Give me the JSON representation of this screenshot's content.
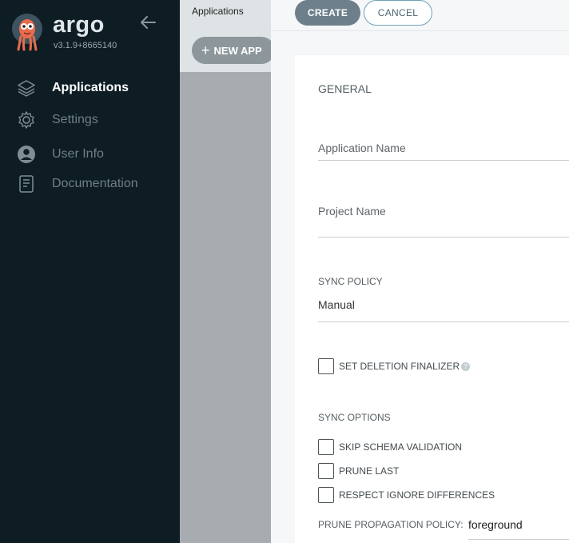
{
  "sidebar": {
    "brand": "argo",
    "version": "v3.1.9+8665140",
    "items": [
      {
        "label": "Applications",
        "icon": "layers-icon",
        "active": true
      },
      {
        "label": "Settings",
        "icon": "gear-icon",
        "active": false
      },
      {
        "label": "User Info",
        "icon": "user-icon",
        "active": false
      },
      {
        "label": "Documentation",
        "icon": "book-icon",
        "active": false
      }
    ]
  },
  "app": {
    "breadcrumb": "Applications",
    "new_app_label": "NEW APP"
  },
  "panel": {
    "create_label": "CREATE",
    "cancel_label": "CANCEL",
    "general_title": "GENERAL",
    "application_name_placeholder": "Application Name",
    "project_name_placeholder": "Project Name",
    "sync_policy_label": "SYNC POLICY",
    "sync_policy_value": "Manual",
    "set_deletion_finalizer_label": "SET DELETION FINALIZER",
    "sync_options_label": "SYNC OPTIONS",
    "sync_options": [
      {
        "label": "SKIP SCHEMA VALIDATION",
        "checked": false
      },
      {
        "label": "PRUNE LAST",
        "checked": false
      },
      {
        "label": "RESPECT IGNORE DIFFERENCES",
        "checked": false
      }
    ],
    "prune_propagation_policy_label": "PRUNE PROPAGATION POLICY:",
    "prune_propagation_policy_value": "foreground"
  },
  "colors": {
    "sidebar_bg": "#0e1c24",
    "logo_orange": "#e96d4c",
    "create_button": "#6d7f8b",
    "cancel_border": "#6fa2b6"
  }
}
